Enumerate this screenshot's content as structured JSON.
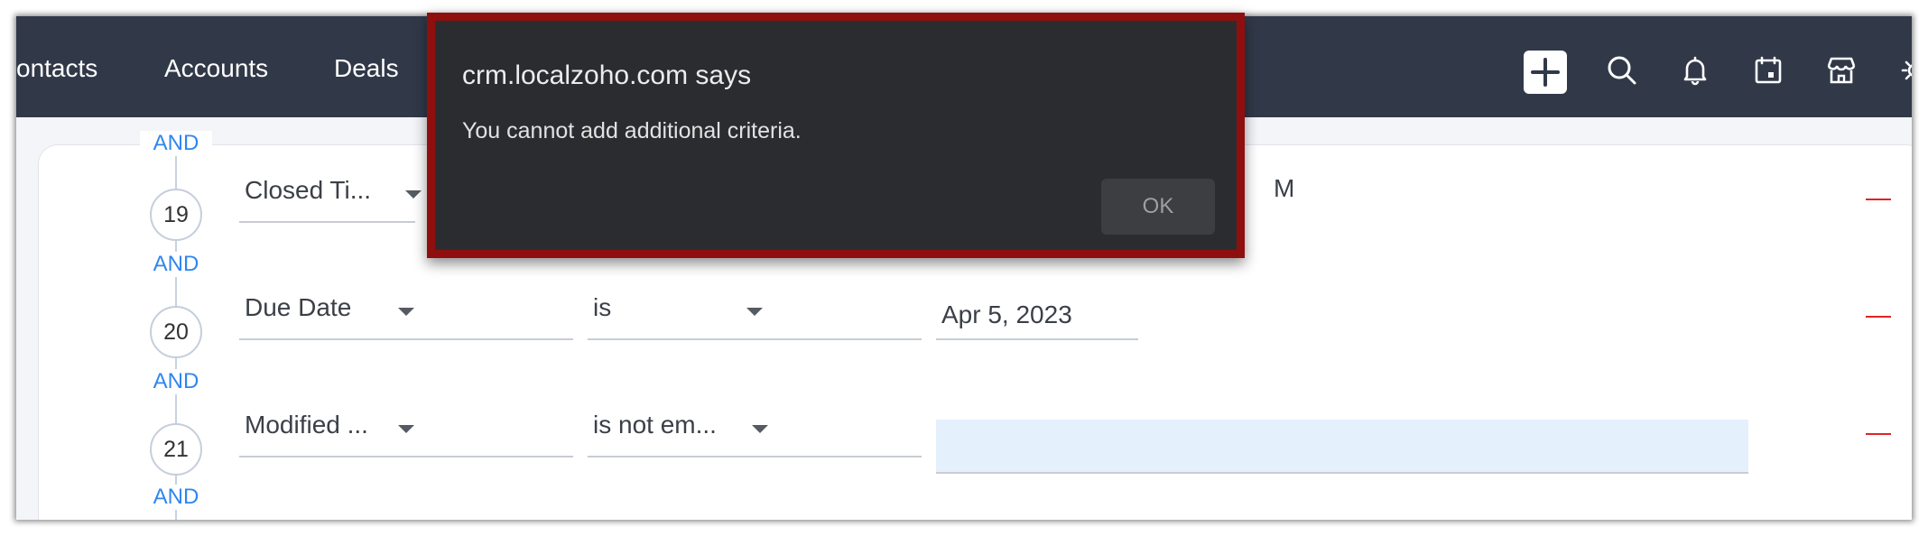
{
  "nav": {
    "items": [
      "ontacts",
      "Accounts",
      "Deals"
    ]
  },
  "icons": [
    "plus-icon",
    "search-icon",
    "bell-icon",
    "calendar-icon",
    "marketplace-icon",
    "gear-icon"
  ],
  "colors": {
    "nav_bg": "#313949",
    "and_blue": "#2f86f0",
    "remove_red": "#e02424",
    "dialog_bg": "#2b2c30",
    "dialog_border": "#8f0f0f",
    "input_highlight": "#e5f0fd"
  },
  "criteria": {
    "join": "AND",
    "rows": [
      {
        "number": "19",
        "field": "Closed Ti...",
        "operator": "",
        "value": "M"
      },
      {
        "number": "20",
        "field": "Due Date",
        "operator": "is",
        "value": "Apr 5, 2023"
      },
      {
        "number": "21",
        "field": "Modified ...",
        "operator": "is not em...",
        "value": ""
      }
    ]
  },
  "dialog": {
    "title": "crm.localzoho.com says",
    "message": "You cannot add additional criteria.",
    "ok_label": "OK"
  }
}
